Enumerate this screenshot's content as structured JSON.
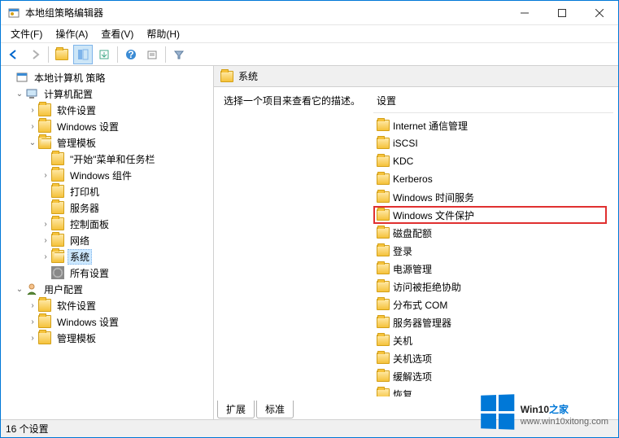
{
  "window": {
    "title": "本地组策略编辑器"
  },
  "menus": [
    "文件(F)",
    "操作(A)",
    "查看(V)",
    "帮助(H)"
  ],
  "tree": {
    "root": "本地计算机 策略",
    "computer": "计算机配置",
    "software": "软件设置",
    "windows": "Windows 设置",
    "templates": "管理模板",
    "startmenu": "\"开始\"菜单和任务栏",
    "wincomp": "Windows 组件",
    "printer": "打印机",
    "server": "服务器",
    "cpanel": "控制面板",
    "network": "网络",
    "system": "系统",
    "allsettings": "所有设置",
    "user": "用户配置",
    "usoftware": "软件设置",
    "uwindows": "Windows 设置",
    "utemplates": "管理模板"
  },
  "right": {
    "header": "系统",
    "desc": "选择一个项目来查看它的描述。",
    "settings_header": "设置",
    "items": [
      "Internet 通信管理",
      "iSCSI",
      "KDC",
      "Kerberos",
      "Windows 时间服务",
      "Windows 文件保护",
      "磁盘配额",
      "登录",
      "电源管理",
      "访问被拒绝协助",
      "分布式 COM",
      "服务器管理器",
      "关机",
      "关机选项",
      "缓解选项",
      "恢复"
    ],
    "highlighted_index": 5
  },
  "tabs": [
    "扩展",
    "标准"
  ],
  "statusbar": "16 个设置",
  "watermark": {
    "brand1": "Win10",
    "brand2": "之家",
    "url": "www.win10xitong.com"
  }
}
